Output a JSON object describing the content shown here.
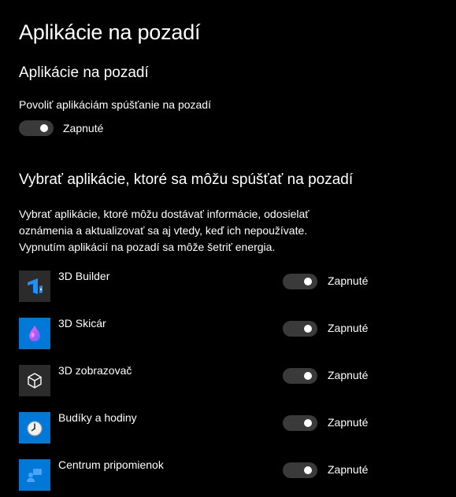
{
  "page": {
    "title": "Aplikácie na pozadí"
  },
  "background_section": {
    "title": "Aplikácie na pozadí",
    "allow_label": "Povoliť aplikáciám spúšťanie na pozadí",
    "allow_toggle_state": "Zapnuté",
    "allow_toggle_on": true
  },
  "choose_section": {
    "title": "Vybrať aplikácie, ktoré sa môžu spúšťať na pozadí",
    "description": [
      "Vybrať aplikácie, ktoré môžu dostávať informácie, odosielať",
      "oznámenia a aktualizovať sa aj vtedy, keď ich nepoužívate.",
      "Vypnutím aplikácií na pozadí sa môže šetriť energia."
    ]
  },
  "apps": [
    {
      "name": "3D Builder",
      "state": "Zapnuté",
      "on": true,
      "icon": "3d-builder-icon",
      "tile_color": "#2b2b2b"
    },
    {
      "name": "3D Skicár",
      "state": "Zapnuté",
      "on": true,
      "icon": "paint-3d-icon",
      "tile_color": "#0078d7"
    },
    {
      "name": "3D zobrazovač",
      "state": "Zapnuté",
      "on": true,
      "icon": "3d-viewer-icon",
      "tile_color": "#2b2b2b"
    },
    {
      "name": "Budíky a hodiny",
      "state": "Zapnuté",
      "on": true,
      "icon": "alarm-clock-icon",
      "tile_color": "#0078d7"
    },
    {
      "name": "Centrum pripomienok",
      "state": "Zapnuté",
      "on": true,
      "icon": "feedback-hub-icon",
      "tile_color": "#0078d7"
    }
  ],
  "colors": {
    "background": "#000000",
    "text": "#ffffff",
    "toggle_track": "#3a3a3a",
    "accent_blue": "#0078d7"
  }
}
